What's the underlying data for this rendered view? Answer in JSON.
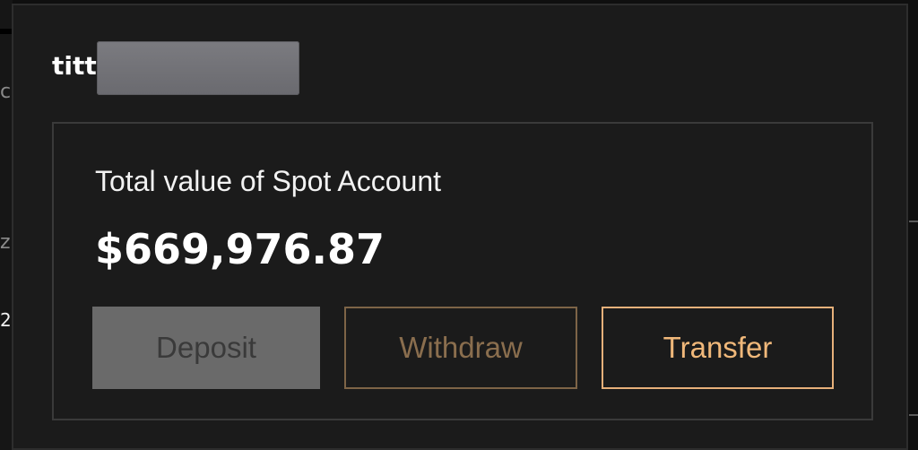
{
  "background": {
    "fragments": [
      "c",
      "z",
      "2"
    ]
  },
  "account": {
    "username_visible": "titt",
    "username_redacted": true
  },
  "spot": {
    "label": "Total value of Spot Account",
    "total_value": "$669,976.87"
  },
  "actions": {
    "deposit_label": "Deposit",
    "withdraw_label": "Withdraw",
    "transfer_label": "Transfer"
  },
  "colors": {
    "panel_bg": "#1b1b1b",
    "accent_gold": "#e6b07a",
    "withdraw_border": "#7d6447",
    "deposit_bg": "#6a6a6a"
  }
}
